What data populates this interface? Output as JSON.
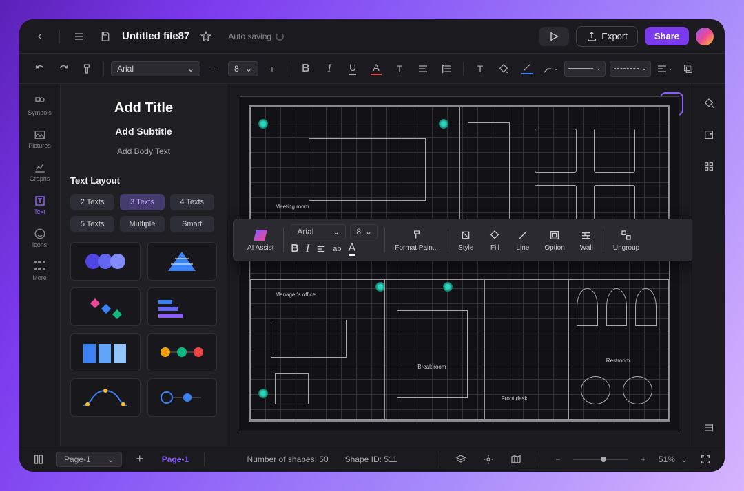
{
  "header": {
    "filename": "Untitled file87",
    "status": "Auto saving",
    "export_label": "Export",
    "share_label": "Share"
  },
  "toolbar": {
    "font": "Arial",
    "font_size": "8"
  },
  "rail": {
    "items": [
      {
        "label": "Symbols"
      },
      {
        "label": "Pictures"
      },
      {
        "label": "Graphs"
      },
      {
        "label": "Text"
      },
      {
        "label": "Icons"
      },
      {
        "label": "More"
      }
    ]
  },
  "sidepanel": {
    "preset": {
      "title": "Add Title",
      "subtitle": "Add Subtitle",
      "body": "Add Body Text"
    },
    "section": "Text Layout",
    "pills": [
      "2 Texts",
      "3 Texts",
      "4 Texts",
      "5 Texts",
      "Multiple",
      "Smart"
    ]
  },
  "context_toolbar": {
    "font": "Arial",
    "size": "8",
    "items": [
      "AI Assist",
      "Format Pain...",
      "Style",
      "Fill",
      "Line",
      "Option",
      "Wall",
      "Ungroup"
    ]
  },
  "canvas": {
    "rooms": {
      "meeting": "Meeting room",
      "manager": "Manager's office",
      "break": "Break room",
      "front": "Front desk",
      "restroom": "Restroom"
    }
  },
  "status": {
    "page_selector": "Page-1",
    "page_tab": "Page-1",
    "shapes": "Number of shapes: 50",
    "shape_id": "Shape ID: 511",
    "zoom": "51%"
  }
}
